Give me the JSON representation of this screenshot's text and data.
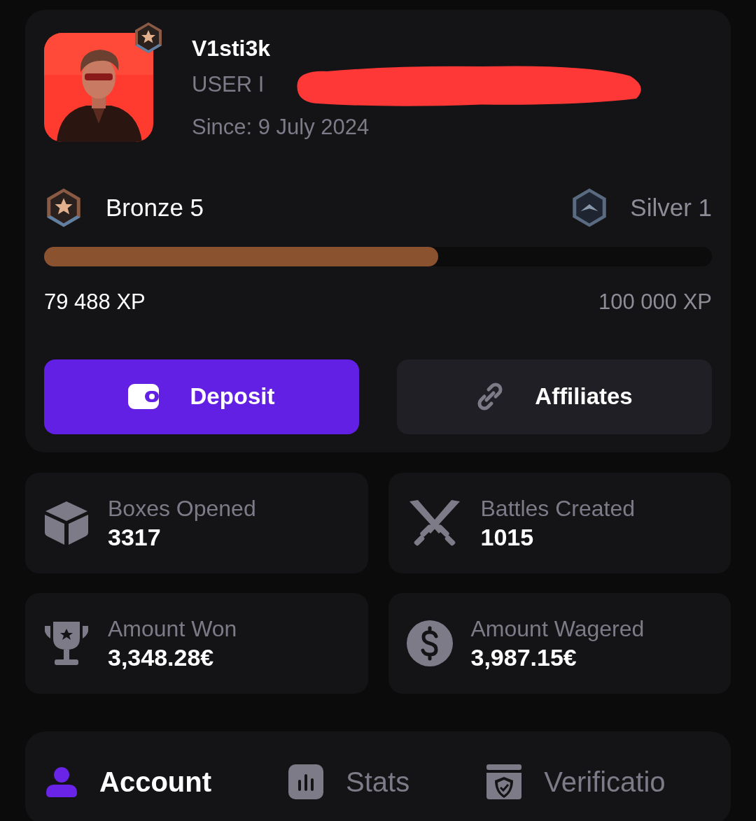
{
  "profile": {
    "username": "V1sti3k",
    "user_id_label": "USER I",
    "since": "Since: 9 July 2024"
  },
  "rank": {
    "current": {
      "name": "Bronze 5",
      "kind": "bronze"
    },
    "next": {
      "name": "Silver 1",
      "kind": "silver"
    },
    "level": 0.59,
    "xp_current": "79 488 XP",
    "xp_target": "100 000 XP"
  },
  "buttons": [
    {
      "label": "Deposit",
      "kind": "primary"
    },
    {
      "label": "Affiliates",
      "kind": "secondary"
    }
  ],
  "stats": [
    {
      "label": "Boxes Opened",
      "value": "3317"
    },
    {
      "label": "Battles Created",
      "value": "1015"
    },
    {
      "label": "Amount Won",
      "value": "3,348.28€"
    },
    {
      "label": "Amount Wagered",
      "value": "3,987.15€"
    }
  ],
  "tabs": [
    {
      "label": "Account",
      "selected": true
    },
    {
      "label": "Stats",
      "selected": false
    },
    {
      "label": "Verificatio",
      "selected": false
    }
  ]
}
